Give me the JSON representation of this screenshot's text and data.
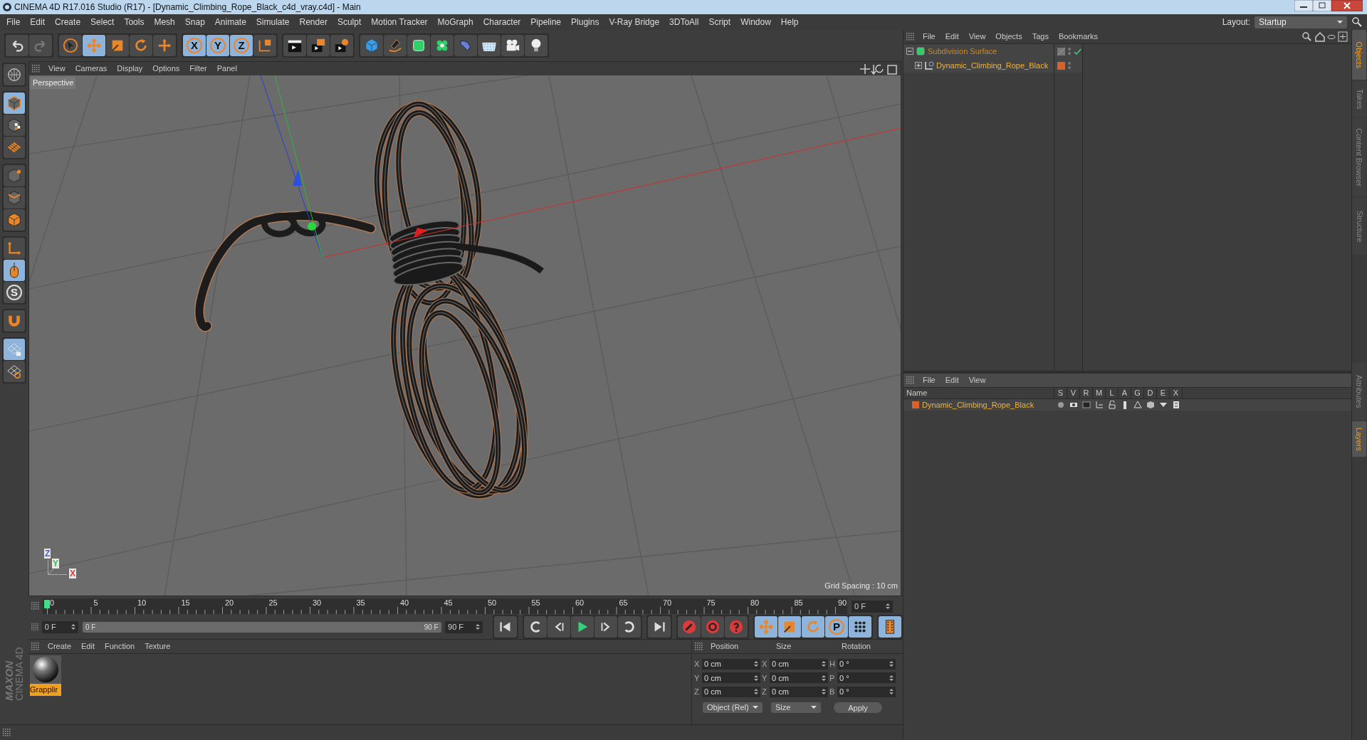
{
  "window": {
    "title": "CINEMA 4D R17.016 Studio (R17) - [Dynamic_Climbing_Rope_Black_c4d_vray.c4d] - Main"
  },
  "menu_bar": [
    "File",
    "Edit",
    "Create",
    "Select",
    "Tools",
    "Mesh",
    "Snap",
    "Animate",
    "Simulate",
    "Render",
    "Sculpt",
    "Motion Tracker",
    "MoGraph",
    "Character",
    "Pipeline",
    "Plugins",
    "V-Ray Bridge",
    "3DToAll",
    "Script",
    "Window",
    "Help"
  ],
  "layout": {
    "label": "Layout:",
    "value": "Startup"
  },
  "toolbar": [
    {
      "kind": "undo",
      "selected": false
    },
    {
      "kind": "redo",
      "selected": false
    },
    {
      "kind": "select",
      "selected": false
    },
    {
      "kind": "move",
      "selected": true
    },
    {
      "kind": "scale",
      "selected": false
    },
    {
      "kind": "rotate",
      "selected": false
    },
    {
      "kind": "move-plus",
      "selected": false
    },
    {
      "kind": "axis",
      "label": "X",
      "selected": true
    },
    {
      "kind": "axis",
      "label": "Y",
      "selected": true
    },
    {
      "kind": "axis",
      "label": "Z",
      "selected": true
    },
    {
      "kind": "coord",
      "selected": false
    },
    {
      "kind": "clapper",
      "selected": false
    },
    {
      "kind": "clapper-orange",
      "selected": false
    },
    {
      "kind": "clapper-gear",
      "selected": false
    },
    {
      "kind": "cube",
      "selected": false
    },
    {
      "kind": "pen",
      "selected": false
    },
    {
      "kind": "subdivision",
      "selected": false
    },
    {
      "kind": "cloner",
      "selected": false
    },
    {
      "kind": "deformer",
      "selected": false
    },
    {
      "kind": "floor",
      "selected": false
    },
    {
      "kind": "camera",
      "selected": false
    },
    {
      "kind": "light",
      "selected": false
    }
  ],
  "left_tools": [
    {
      "kind": "globe",
      "selected": false
    },
    {
      "kind": "model",
      "selected": true
    },
    {
      "kind": "texture",
      "selected": false
    },
    {
      "kind": "workplane",
      "selected": false
    },
    {
      "kind": "points",
      "selected": false
    },
    {
      "kind": "edges",
      "selected": false
    },
    {
      "kind": "polygons",
      "selected": false
    },
    {
      "kind": "axis-l",
      "selected": false
    },
    {
      "kind": "tweak",
      "selected": true
    },
    {
      "kind": "snap",
      "label": "S",
      "selected": false
    },
    {
      "kind": "magnet",
      "selected": false
    },
    {
      "kind": "grid-lock",
      "selected": true
    },
    {
      "kind": "grid-rotate",
      "selected": false
    }
  ],
  "viewport": {
    "menu": [
      "View",
      "Cameras",
      "Display",
      "Options",
      "Filter",
      "Panel"
    ],
    "camera": "Perspective",
    "grid_spacing": "Grid Spacing : 10 cm",
    "axis_labels": [
      {
        "text": "Z",
        "color": "#3a5fe0"
      },
      {
        "text": "Y",
        "color": "#3ac24a"
      },
      {
        "text": "X",
        "color": "#e03a3a"
      }
    ]
  },
  "timeline": {
    "ticks": [
      "0",
      "5",
      "10",
      "15",
      "20",
      "25",
      "30",
      "35",
      "40",
      "45",
      "50",
      "55",
      "60",
      "65",
      "70",
      "75",
      "80",
      "85",
      "90"
    ],
    "current_frame": "0 F",
    "start": "0 F",
    "range": {
      "start": "0 F",
      "end": "90 F",
      "level": 1
    },
    "end": "90 F"
  },
  "transport": [
    {
      "kind": "first",
      "selected": false
    },
    {
      "kind": "loop-back",
      "selected": false
    },
    {
      "kind": "prev-key",
      "selected": false
    },
    {
      "kind": "play",
      "selected": false
    },
    {
      "kind": "next-key",
      "selected": false
    },
    {
      "kind": "loop",
      "selected": false
    },
    {
      "kind": "last",
      "selected": false
    },
    {
      "kind": "record",
      "selected": false
    },
    {
      "kind": "autokey",
      "selected": false
    },
    {
      "kind": "keyhelp",
      "selected": false
    },
    {
      "kind": "move",
      "selected": true
    },
    {
      "kind": "scale",
      "selected": true
    },
    {
      "kind": "rotate",
      "selected": true
    },
    {
      "kind": "param",
      "label": "P",
      "selected": true
    },
    {
      "kind": "dots",
      "selected": true
    },
    {
      "kind": "film",
      "selected": true
    }
  ],
  "material_manager": {
    "menu": [
      "Create",
      "Edit",
      "Function",
      "Texture"
    ],
    "materials": [
      {
        "name": "Grapplir",
        "selected": true
      }
    ]
  },
  "logo": {
    "brand": "MAXON",
    "product": "CINEMA 4D"
  },
  "coordinates": {
    "headers": [
      "Position",
      "Size",
      "Rotation"
    ],
    "rows": [
      [
        {
          "axis": "X",
          "value": "0 cm"
        },
        {
          "axis": "X",
          "value": "0 cm"
        },
        {
          "axis": "H",
          "value": "0 °"
        }
      ],
      [
        {
          "axis": "Y",
          "value": "0 cm"
        },
        {
          "axis": "Y",
          "value": "0 cm"
        },
        {
          "axis": "P",
          "value": "0 °"
        }
      ],
      [
        {
          "axis": "Z",
          "value": "0 cm"
        },
        {
          "axis": "Z",
          "value": "0 cm"
        },
        {
          "axis": "B",
          "value": "0 °"
        }
      ]
    ],
    "mode": "Object (Rel)",
    "size_mode": "Size",
    "apply": "Apply"
  },
  "object_manager": {
    "menu": [
      "File",
      "Edit",
      "View",
      "Objects",
      "Tags",
      "Bookmarks"
    ],
    "objects": [
      {
        "name": "Subdivision Surface",
        "kind": "subdivision",
        "expanded": true,
        "children": [
          {
            "name": "Dynamic_Climbing_Rope_Black",
            "kind": "null",
            "expanded": false,
            "color": "#d9622b"
          }
        ]
      }
    ]
  },
  "side_tabs_top": [
    {
      "label": "Objects",
      "selected": true
    },
    {
      "label": "Takes",
      "selected": false
    },
    {
      "label": "Content Browser",
      "selected": false
    },
    {
      "label": "Structure",
      "selected": false
    }
  ],
  "side_tabs_bottom": [
    {
      "label": "Attributes",
      "selected": false
    },
    {
      "label": "Layers",
      "selected": true
    }
  ],
  "layer_manager": {
    "menu": [
      "File",
      "Edit",
      "View"
    ],
    "columns": [
      "Name",
      "S",
      "V",
      "R",
      "M",
      "L",
      "A",
      "G",
      "D",
      "E",
      "X"
    ],
    "layers": [
      {
        "name": "Dynamic_Climbing_Rope_Black",
        "color": "#d9622b"
      }
    ]
  }
}
